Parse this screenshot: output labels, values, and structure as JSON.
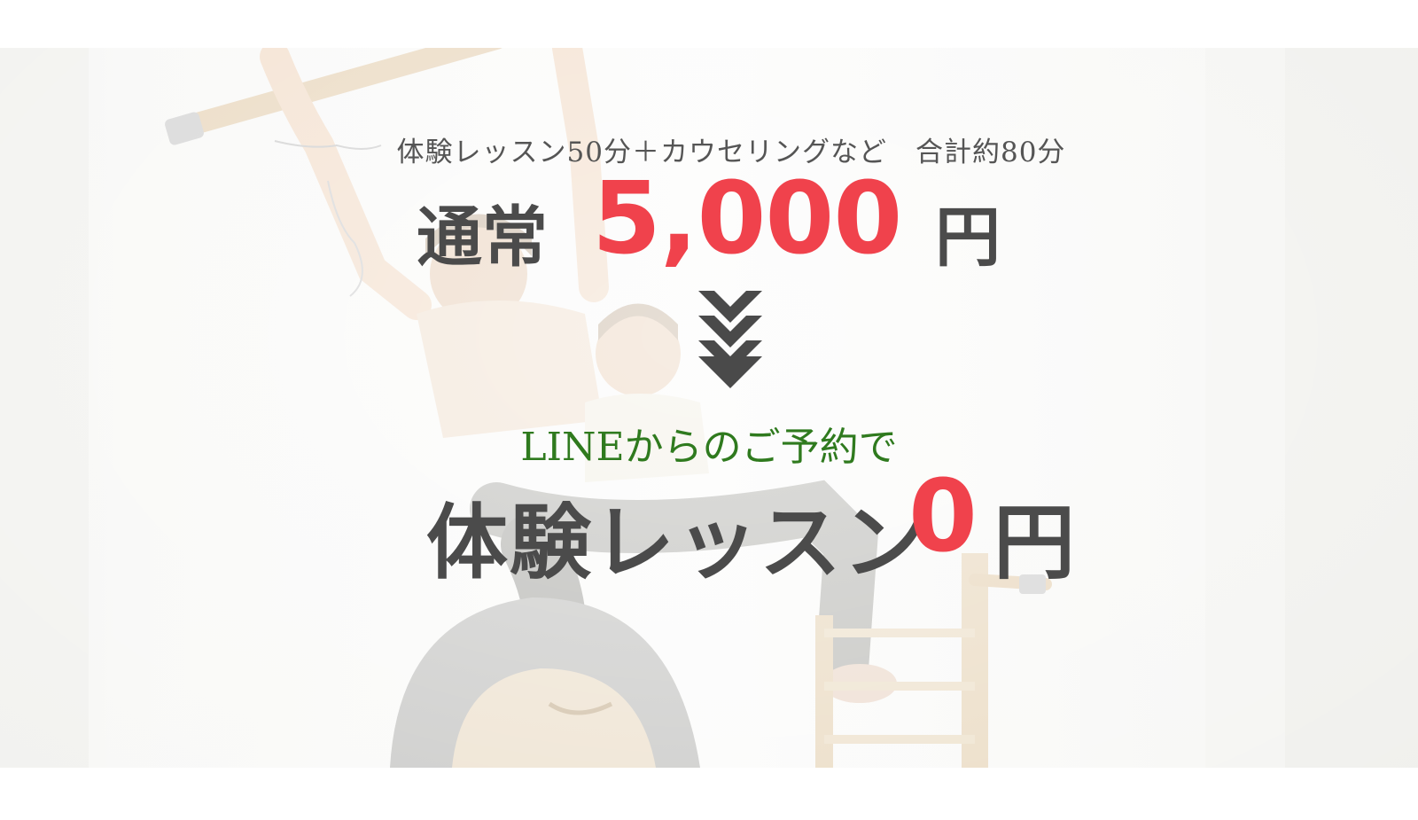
{
  "offer": {
    "subtitle": "体験レッスン50分＋カウセリングなど　合計約80分",
    "normal_label": "通常",
    "normal_price": "5,000",
    "normal_unit": "円",
    "line_note": "LINEからのご予約で",
    "trial_label": "体験レッスン",
    "trial_price": "0",
    "trial_unit": "円"
  },
  "colors": {
    "accent_red": "#f0424c",
    "line_green": "#2f7a1e",
    "text_dark": "#4b4b4b",
    "arrow_gray": "#4a4a4a"
  },
  "icons": {
    "arrow": "double-chevron-down-icon"
  }
}
